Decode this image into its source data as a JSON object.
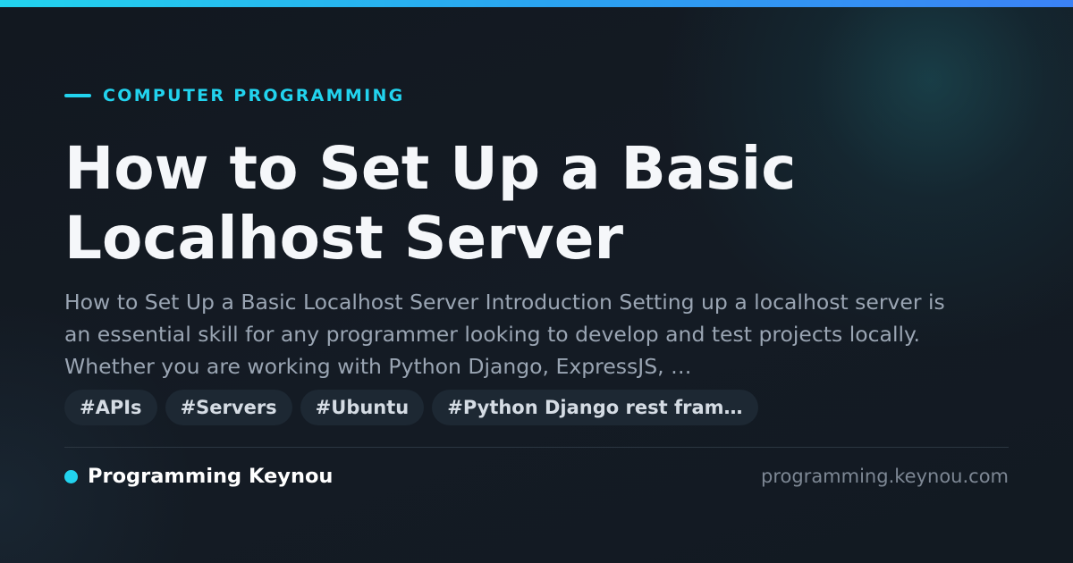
{
  "accent_color": "#22d3ee",
  "category": "COMPUTER PROGRAMMING",
  "title": "How to Set Up a Basic Localhost Server",
  "description": "How to Set Up a Basic Localhost Server Introduction Setting up a localhost server is an essential skill for any programmer looking to develop and test projects locally. Whether you are working with Python Django, ExpressJS, …",
  "tags": [
    {
      "label": "#APIs"
    },
    {
      "label": "#Servers"
    },
    {
      "label": "#Ubuntu"
    },
    {
      "label": "#Python Django rest fram…"
    }
  ],
  "footer": {
    "site_name": "Programming Keynou",
    "domain": "programming.keynou.com"
  }
}
